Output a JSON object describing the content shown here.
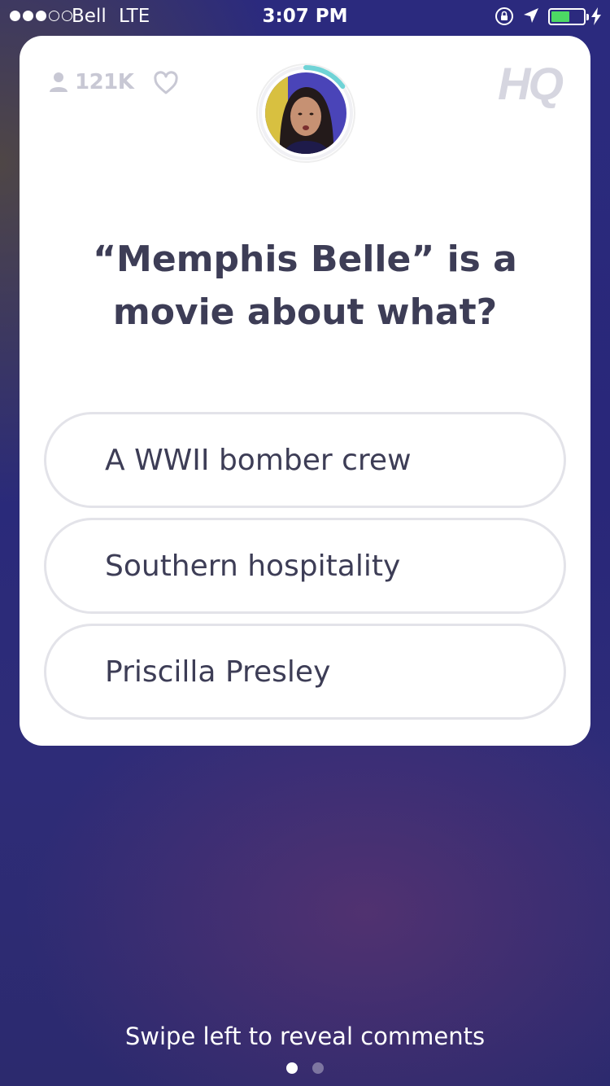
{
  "status_bar": {
    "signal_bars": 3,
    "signal_total": 5,
    "carrier": "Bell",
    "network": "LTE",
    "time": "3:07 PM",
    "battery_level": 0.62,
    "battery_color": "#4cd964"
  },
  "header": {
    "viewer_count": "121K",
    "logo_text": "HQ",
    "timer_progress": 0.15,
    "timer_color": "#6fd3d6"
  },
  "question": {
    "text": "“Memphis Belle” is a movie about what?"
  },
  "answers": [
    {
      "label": "A WWII bomber crew"
    },
    {
      "label": "Southern hospitality"
    },
    {
      "label": "Priscilla Presley"
    }
  ],
  "footer": {
    "hint": "Swipe left to reveal comments",
    "pages": 2,
    "active_page": 0
  }
}
